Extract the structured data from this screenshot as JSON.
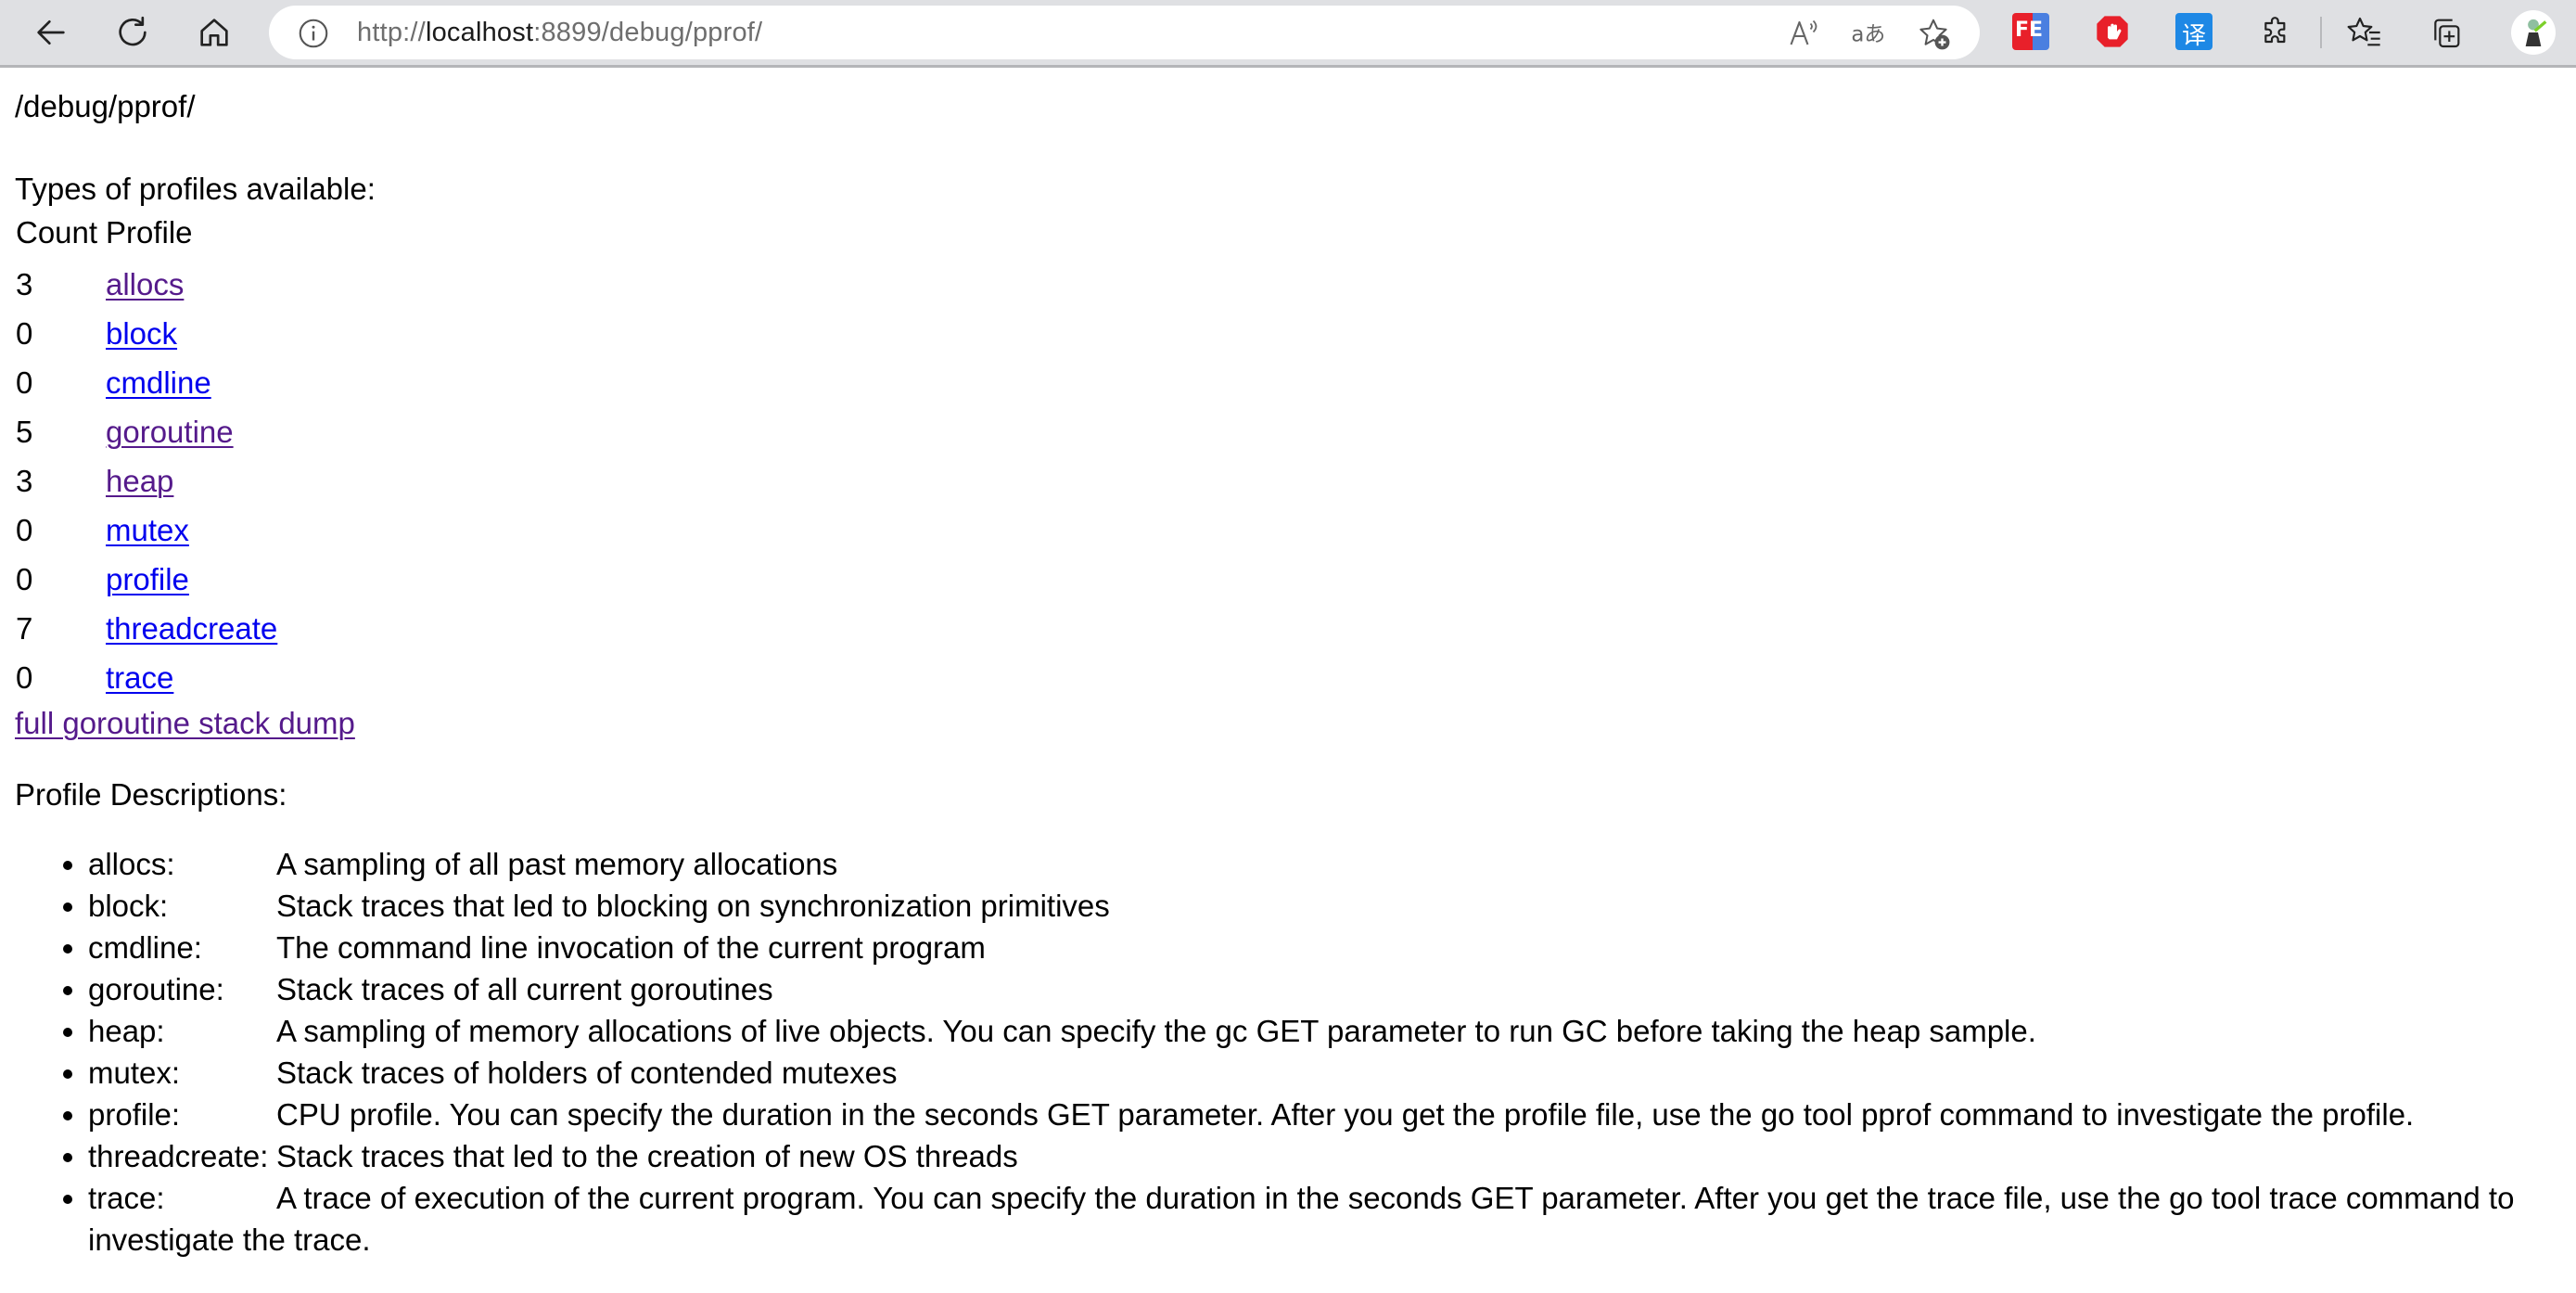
{
  "browser": {
    "url": {
      "scheme": "http://",
      "host": "localhost",
      "rest": ":8899/debug/pprof/"
    },
    "nav": [
      {
        "name": "back-button",
        "icon": "arrow-left-icon"
      },
      {
        "name": "reload-button",
        "icon": "reload-icon"
      },
      {
        "name": "home-button",
        "icon": "home-icon"
      }
    ],
    "omnibox_icons": [
      "read-aloud-icon",
      "translate-icon",
      "add-favorite-icon"
    ],
    "extensions": [
      {
        "name": "fe-helper-extension",
        "label": "FE",
        "color": "#e8202a"
      },
      {
        "name": "adblock-extension",
        "label": "",
        "color": "#e8202a"
      },
      {
        "name": "translate-extension",
        "label": "译",
        "color": "#1e88e5"
      }
    ],
    "toolbar_icons": [
      "extensions-icon",
      "favorites-icon",
      "collections-icon",
      "profile-avatar"
    ]
  },
  "page": {
    "title": "/debug/pprof/",
    "types_heading": "Types of profiles available:",
    "table": {
      "headers": [
        "Count",
        "Profile"
      ],
      "rows": [
        {
          "count": "3",
          "profile": "allocs",
          "visited": true
        },
        {
          "count": "0",
          "profile": "block",
          "visited": false
        },
        {
          "count": "0",
          "profile": "cmdline",
          "visited": false
        },
        {
          "count": "5",
          "profile": "goroutine",
          "visited": true
        },
        {
          "count": "3",
          "profile": "heap",
          "visited": true
        },
        {
          "count": "0",
          "profile": "mutex",
          "visited": false
        },
        {
          "count": "0",
          "profile": "profile",
          "visited": false
        },
        {
          "count": "7",
          "profile": "threadcreate",
          "visited": false
        },
        {
          "count": "0",
          "profile": "trace",
          "visited": false
        }
      ]
    },
    "full_dump_link": "full goroutine stack dump",
    "descriptions_heading": "Profile Descriptions:",
    "descriptions": [
      {
        "name": "allocs:",
        "text": "A sampling of all past memory allocations"
      },
      {
        "name": "block:",
        "text": "Stack traces that led to blocking on synchronization primitives"
      },
      {
        "name": "cmdline:",
        "text": "The command line invocation of the current program"
      },
      {
        "name": "goroutine:",
        "text": "Stack traces of all current goroutines"
      },
      {
        "name": "heap:",
        "text": "A sampling of memory allocations of live objects. You can specify the gc GET parameter to run GC before taking the heap sample."
      },
      {
        "name": "mutex:",
        "text": "Stack traces of holders of contended mutexes"
      },
      {
        "name": "profile:",
        "text": "CPU profile. You can specify the duration in the seconds GET parameter. After you get the profile file, use the go tool pprof command to investigate the profile."
      },
      {
        "name": "threadcreate:",
        "text": "Stack traces that led to the creation of new OS threads"
      },
      {
        "name": "trace:",
        "text": "A trace of execution of the current program. You can specify the duration in the seconds GET parameter. After you get the trace file, use the go tool trace command to investigate the trace."
      }
    ],
    "colors": {
      "link": "#0000ee",
      "visited_link": "#551a8b"
    }
  }
}
